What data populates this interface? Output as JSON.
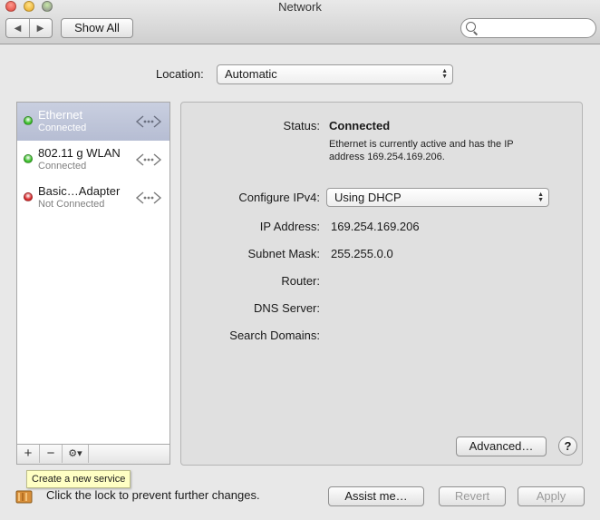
{
  "window": {
    "title": "Network"
  },
  "toolbar": {
    "back_label": "◀",
    "forward_label": "▶",
    "show_all_label": "Show All",
    "search_placeholder": ""
  },
  "location": {
    "label": "Location:",
    "value": "Automatic"
  },
  "services": [
    {
      "name": "Ethernet",
      "state": "Connected",
      "status_color": "#3bbf2a",
      "selected": true
    },
    {
      "name": "802.11 g WLAN",
      "state": "Connected",
      "status_color": "#3bbf2a",
      "selected": false
    },
    {
      "name": "Basic…Adapter",
      "state": "Not Connected",
      "status_color": "#d8282a",
      "selected": false
    }
  ],
  "sidebar_buttons": {
    "add": "+",
    "remove": "−",
    "action": "⚙▾"
  },
  "details": {
    "status_label": "Status:",
    "status_value": "Connected",
    "status_description": "Ethernet is currently active and has the IP address 169.254.169.206.",
    "configure_label": "Configure IPv4:",
    "configure_value": "Using DHCP",
    "ip_label": "IP Address:",
    "ip_value": "169.254.169.206",
    "subnet_label": "Subnet Mask:",
    "subnet_value": "255.255.0.0",
    "router_label": "Router:",
    "router_value": "",
    "dns_label": "DNS Server:",
    "dns_value": "",
    "search_domains_label": "Search Domains:",
    "search_domains_value": "",
    "advanced_label": "Advanced…",
    "help_label": "?"
  },
  "tooltip": "Create a new service",
  "footer": {
    "lock_text": "Click the lock to prevent further changes.",
    "assist_label": "Assist me…",
    "revert_label": "Revert",
    "apply_label": "Apply"
  }
}
